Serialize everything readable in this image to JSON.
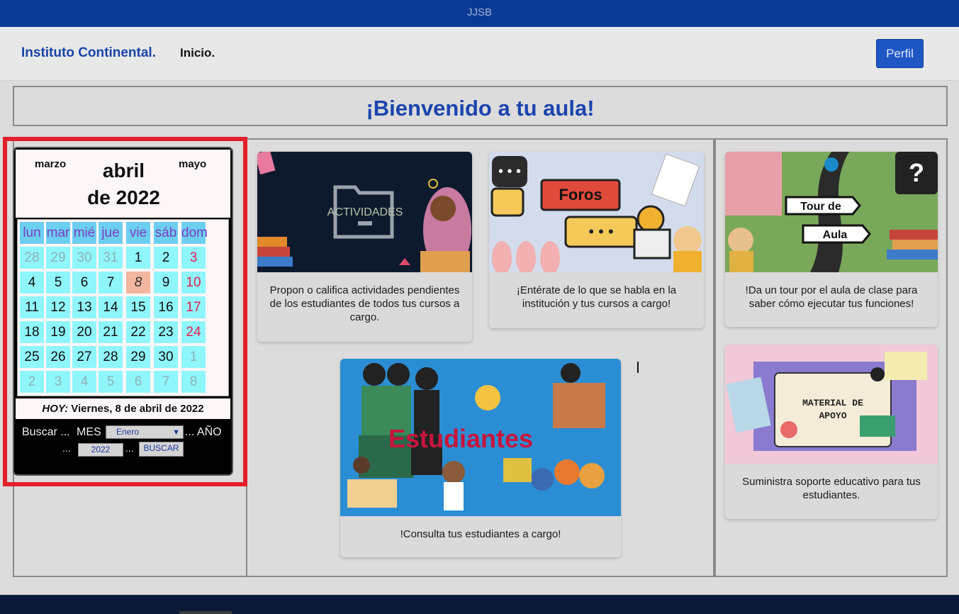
{
  "window": {
    "title": "JJSB"
  },
  "navbar": {
    "brand": "Instituto Continental.",
    "home": "Inicio.",
    "profile_button": "Perfil"
  },
  "welcome": {
    "title": "¡Bienvenido a tu aula!"
  },
  "calendar": {
    "prev_month": "marzo",
    "next_month": "mayo",
    "month": "abril",
    "year_line": "de 2022",
    "weekdays": [
      "lun",
      "mar",
      "mié",
      "jue",
      "vie",
      "sáb",
      "dom"
    ],
    "weeks": [
      [
        "28",
        "29",
        "30",
        "31",
        "1",
        "2",
        "3"
      ],
      [
        "4",
        "5",
        "6",
        "7",
        "8",
        "9",
        "10"
      ],
      [
        "11",
        "12",
        "13",
        "14",
        "15",
        "16",
        "17"
      ],
      [
        "18",
        "19",
        "20",
        "21",
        "22",
        "23",
        "24"
      ],
      [
        "25",
        "26",
        "27",
        "28",
        "29",
        "30",
        "1"
      ],
      [
        "2",
        "3",
        "4",
        "5",
        "6",
        "7",
        "8"
      ]
    ],
    "today_day": "8",
    "today_label": "HOY:",
    "today_text": " Viernes, 8 de abril de 2022",
    "search_label": "Buscar ...",
    "month_label": "MES",
    "month_select_value": "Enero",
    "year_label": "... AÑO",
    "dots_left": "...",
    "year_input_value": "2022",
    "dots_right": "...",
    "search_button": "BUSCAR"
  },
  "cards": {
    "actividades": {
      "image_text": "ACTIVIDADES",
      "text": "Propon o califica actividades pendientes de los estudiantes de todos tus cursos a cargo."
    },
    "foros": {
      "image_text": "Foros",
      "text": "¡Entérate de lo que se habla en la institución y tus cursos a cargo!"
    },
    "tour": {
      "image_text_1": "Tour de",
      "image_text_2": "Aula",
      "text": "!Da un tour por el aula de clase para saber cómo ejecutar tus funciones!"
    },
    "estudiantes": {
      "image_text": "Estudiantes",
      "text": "!Consulta tus estudiantes a cargo!"
    },
    "material": {
      "image_text_1": "MATERIAL DE",
      "image_text_2": "APOYO",
      "text": "Suministra soporte educativo para tus estudiantes."
    }
  },
  "colors": {
    "topbar": "#0b3a94",
    "accent": "#1e56c4",
    "highlight": "#e2202a"
  }
}
